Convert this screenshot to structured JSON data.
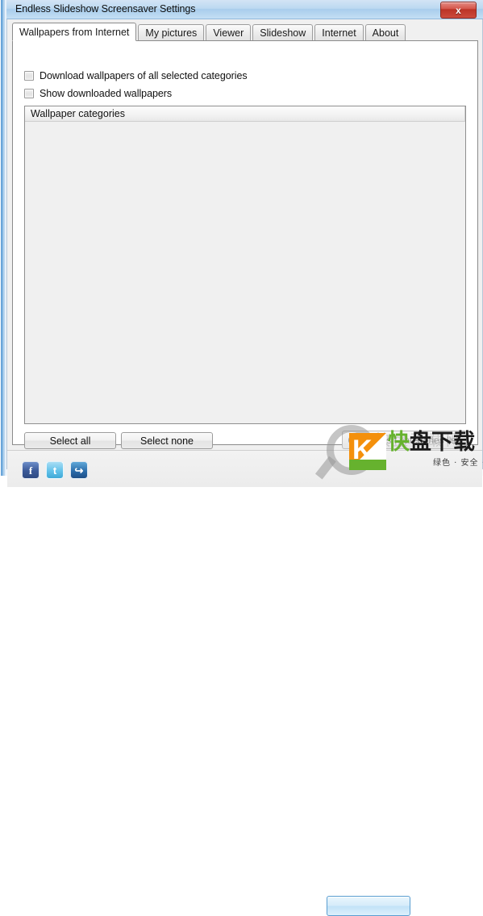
{
  "window": {
    "title": "Endless Slideshow Screensaver Settings",
    "close_label": "x",
    "close_icon": "close-icon",
    "frame_accent": "#5b9bd5",
    "titlebar_color": "#bcd9f1"
  },
  "tabs": [
    {
      "label": "Wallpapers from Internet",
      "active": true
    },
    {
      "label": "My pictures",
      "active": false
    },
    {
      "label": "Viewer",
      "active": false
    },
    {
      "label": "Slideshow",
      "active": false
    },
    {
      "label": "Internet",
      "active": false
    },
    {
      "label": "About",
      "active": false
    }
  ],
  "options": {
    "download_all": {
      "label": "Download wallpapers of all selected categories",
      "checked": false
    },
    "show_downloaded": {
      "label": "Show downloaded wallpapers",
      "checked": false
    }
  },
  "categories": {
    "column_header": "Wallpaper categories",
    "rows": []
  },
  "buttons": {
    "select_all": "Select all",
    "select_none": "Select none",
    "refresh": {
      "label": "Refresh categories list",
      "icon": "refresh-icon",
      "disabled": true
    }
  },
  "status_bar": {
    "social": [
      {
        "name": "facebook-icon",
        "glyph": "f"
      },
      {
        "name": "twitter-icon",
        "glyph": "t"
      },
      {
        "name": "share-icon",
        "glyph": "↪"
      }
    ],
    "apply_label": ""
  },
  "watermark": {
    "logo_letter": "K",
    "title_green": "快",
    "title_dark": "盘下载",
    "subtitle": "绿色 · 安全 · 高速",
    "ghost_text": "快盘下载网",
    "green": "#66b22e",
    "orange": "#f4900c"
  }
}
